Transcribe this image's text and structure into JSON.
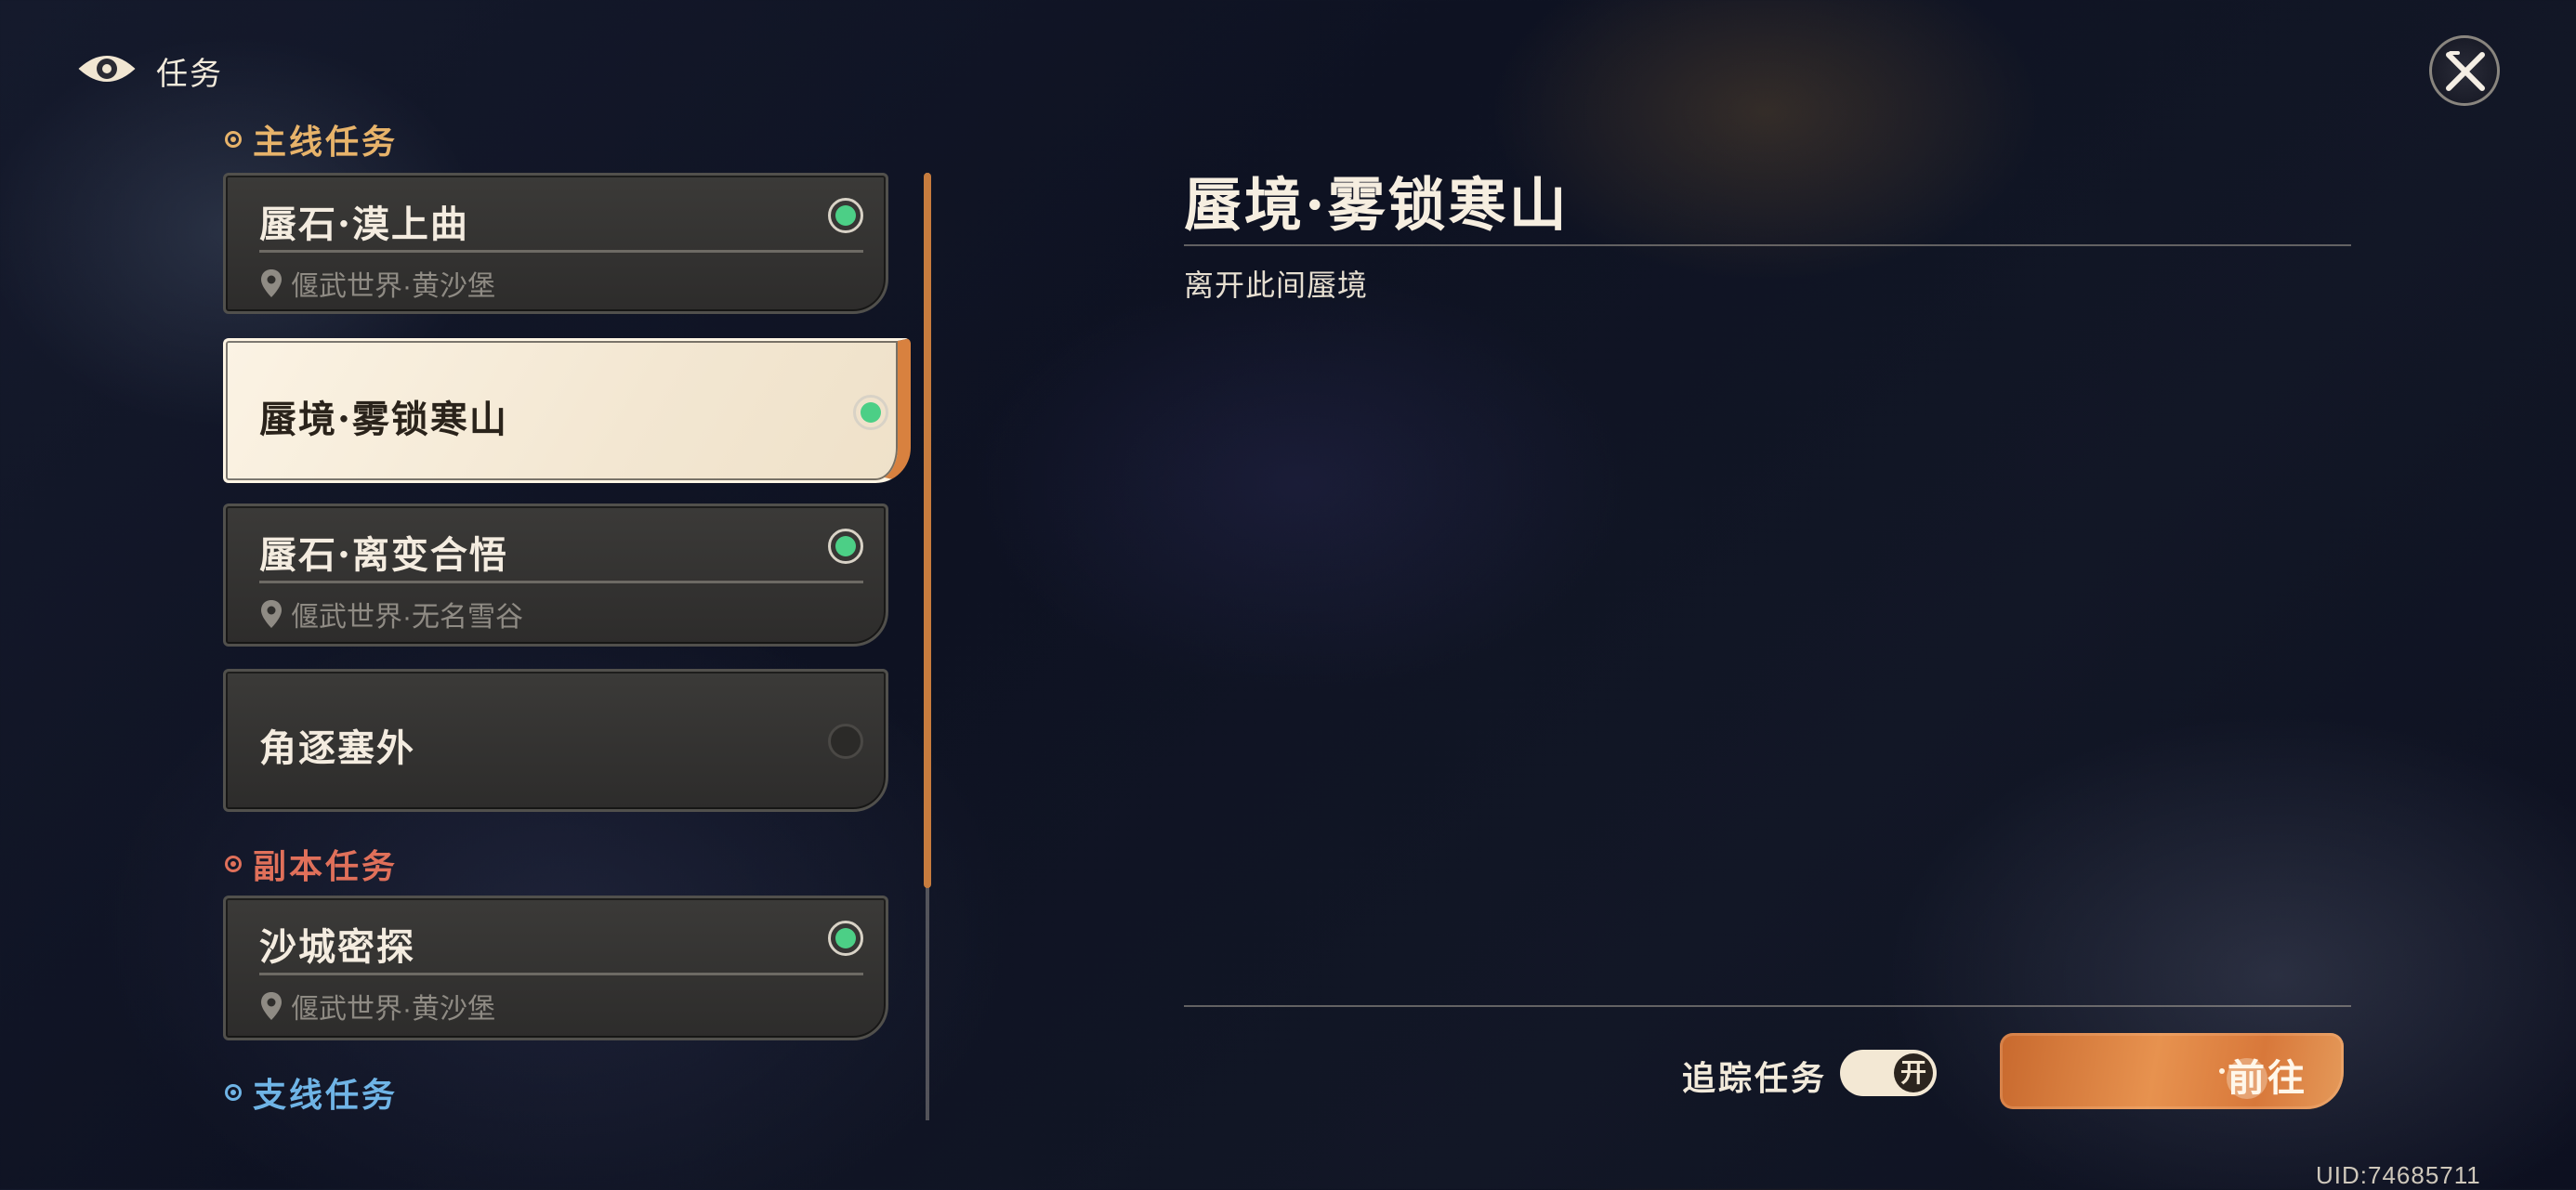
{
  "header": {
    "title": "任务",
    "eye_icon": "eye-icon",
    "close_icon": "close-icon"
  },
  "sections": {
    "main": {
      "label": "主线任务",
      "color": "#e7b36a"
    },
    "instance": {
      "label": "副本任务",
      "color": "#e0705a"
    },
    "side": {
      "label": "支线任务",
      "color": "#6fb4e6"
    }
  },
  "quests": [
    {
      "name": "蜃石·漠上曲",
      "location": "偃武世界·黄沙堡",
      "status": "active"
    },
    {
      "name": "蜃境·雾锁寒山",
      "location": "",
      "status": "active",
      "selected": true
    },
    {
      "name": "蜃石·离变合悟",
      "location": "偃武世界·无名雪谷",
      "status": "active"
    },
    {
      "name": "角逐塞外",
      "location": "",
      "status": "inactive"
    },
    {
      "name": "沙城密探",
      "location": "偃武世界·黄沙堡",
      "status": "active"
    }
  ],
  "detail": {
    "title": "蜃境·雾锁寒山",
    "description": "离开此间蜃境"
  },
  "footer": {
    "track_label": "追踪任务",
    "toggle_text": "开",
    "go_button_first": "前",
    "go_button_rest": "往",
    "uid": "UID:74685711"
  },
  "colors": {
    "accent_orange": "#d8813f",
    "active_green": "#4ccf86"
  }
}
